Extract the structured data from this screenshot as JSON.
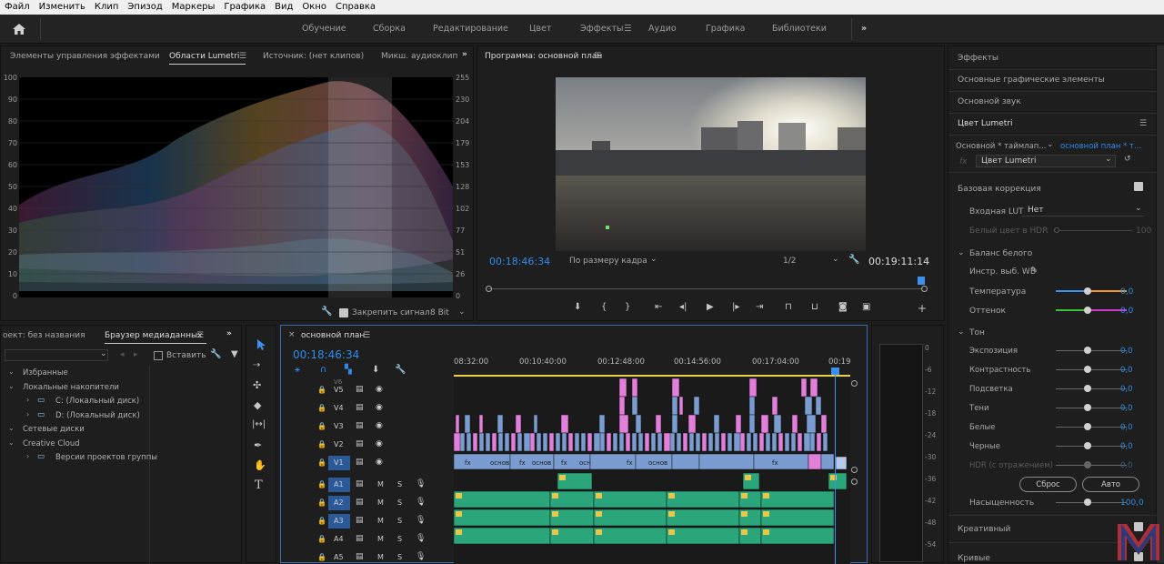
{
  "menu": [
    "Файл",
    "Изменить",
    "Клип",
    "Эпизод",
    "Маркеры",
    "Графика",
    "Вид",
    "Окно",
    "Справка"
  ],
  "workspaces": [
    "Обучение",
    "Сборка",
    "Редактирование",
    "Цвет",
    "Эффекты",
    "Аудио",
    "Графика",
    "Библиотеки"
  ],
  "active_workspace": "Эффекты",
  "left_panel": {
    "tabs": [
      "Элементы управления эффектами",
      "Области Lumetri",
      "Источник: (нет клипов)",
      "Микш. аудиоклип"
    ],
    "scope_left_ticks": [
      "100",
      "90",
      "80",
      "70",
      "60",
      "50",
      "40",
      "30",
      "20",
      "10",
      "0"
    ],
    "scope_right_ticks": [
      "255",
      "230",
      "204",
      "179",
      "153",
      "128",
      "102",
      "77",
      "51",
      "26",
      "0"
    ],
    "clamp_label": "Закрепить сигнал",
    "bit_depth": "8 Bit"
  },
  "program": {
    "title": "Программа: основной план",
    "timecode_left": "00:18:46:34",
    "fit": "По размеру кадра",
    "res": "1/2",
    "timecode_right": "00:19:11:14"
  },
  "project": {
    "tabs": [
      "оект: без названия",
      "Браузер медиаданных"
    ],
    "insert_label": "Вставить",
    "tree": [
      {
        "label": "Избранные",
        "indent": 0
      },
      {
        "label": "Локальные накопители",
        "indent": 0
      },
      {
        "label": "C: (Локальный диск)",
        "indent": 1
      },
      {
        "label": "D: (Локальный диск)",
        "indent": 1
      },
      {
        "label": "Сетевые диски",
        "indent": 0
      },
      {
        "label": "Creative Cloud",
        "indent": 0
      },
      {
        "label": "Версии проектов группы",
        "indent": 1
      }
    ]
  },
  "timeline": {
    "title": "основной план",
    "timecode": "00:18:46:34",
    "ruler": [
      "08:32:00",
      "00:10:40:00",
      "00:12:48:00",
      "00:14:56:00",
      "00:17:04:00",
      "00:19"
    ],
    "video_tracks": [
      "V5",
      "V4",
      "V3",
      "V2",
      "V1"
    ],
    "audio_tracks": [
      "A1",
      "A2",
      "A3",
      "A4",
      "A5"
    ],
    "top_track_label": "V6",
    "clip_label": "основ",
    "clip_label_alt": "осн",
    "audio_meter_ticks": [
      "0",
      "-6",
      "-12",
      "-18",
      "-24",
      "-30",
      "-36",
      "-42",
      "-48",
      "-54"
    ]
  },
  "right_panel": {
    "sections": [
      "Эффекты",
      "Основные графические элементы",
      "Основной звук",
      "Цвет Lumetri"
    ],
    "source_label": "Основной * таймлап...",
    "sequence_label": "основной план * т...",
    "effect_name": "Цвет Lumetri",
    "basic_correction": "Базовая коррекция",
    "input_lut_label": "Входная LUT",
    "input_lut_value": "Нет",
    "hdr_white_label": "Белый цвет в HDR",
    "hdr_white_value": "100",
    "white_balance": "Баланс белого",
    "wb_picker": "Инстр. выб. WB",
    "temperature": {
      "label": "Температура",
      "value": "0,0"
    },
    "tint": {
      "label": "Оттенок",
      "value": "0,0"
    },
    "tone": "Тон",
    "tone_sliders": [
      {
        "label": "Экспозиция",
        "value": "0,0"
      },
      {
        "label": "Контрастность",
        "value": "0,0"
      },
      {
        "label": "Подсветка",
        "value": "0,0"
      },
      {
        "label": "Тени",
        "value": "0,0"
      },
      {
        "label": "Белые",
        "value": "0,0"
      },
      {
        "label": "Черные",
        "value": "0,0"
      },
      {
        "label": "HDR (с отражением)",
        "value": "0,0"
      }
    ],
    "reset_label": "Сброс",
    "auto_label": "Авто",
    "saturation": {
      "label": "Насыщенность",
      "value": "100,0"
    },
    "creative": "Креативный",
    "curves": "Кривые"
  },
  "colors": {
    "accent": "#2d8ceb",
    "clip_video": "#7a9cd1",
    "clip_pink": "#e27fdb",
    "clip_audio": "#2aa67a",
    "playhead": "#3d8ff0"
  }
}
